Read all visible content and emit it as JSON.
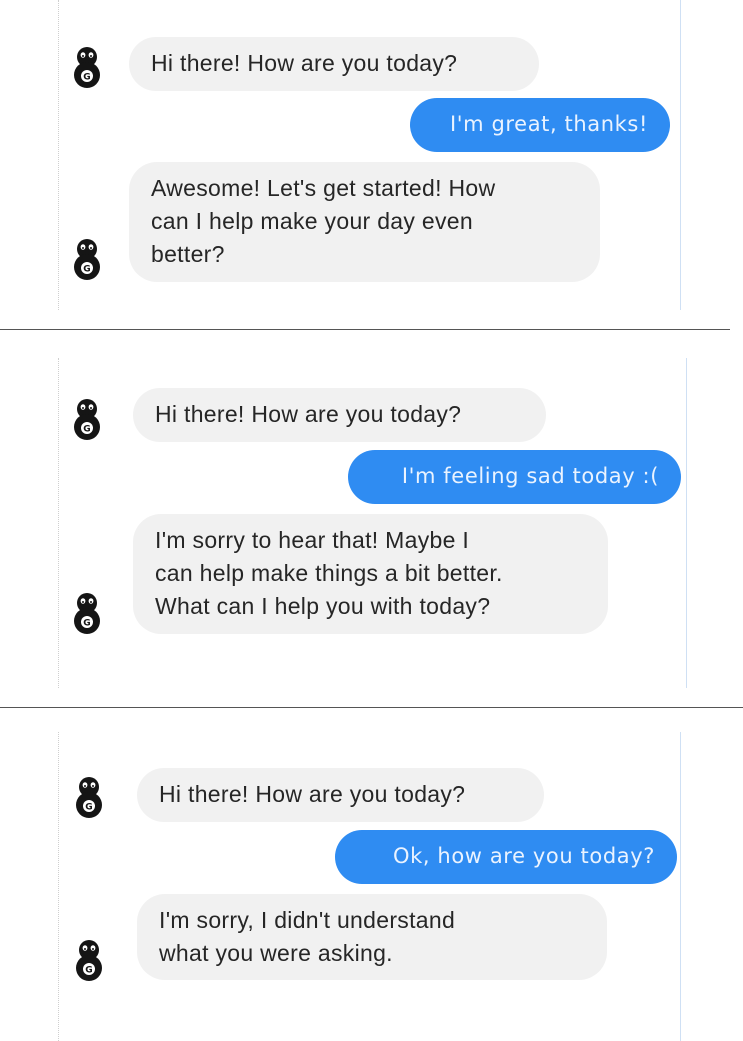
{
  "colors": {
    "user_bubble": "#2f8cf2",
    "user_text": "#eaf3ff",
    "bot_bubble": "#f1f1f1",
    "bot_text": "#262626",
    "divider": "#555555"
  },
  "avatar": {
    "icon": "bot-mascot-icon",
    "badge": "G"
  },
  "panels": [
    {
      "messages": [
        {
          "role": "bot",
          "text": "Hi there! How are you today?"
        },
        {
          "role": "user",
          "text": "I'm great, thanks!"
        },
        {
          "role": "bot",
          "text": "Awesome! Let's get started! How\ncan I help make your day even\nbetter?"
        }
      ]
    },
    {
      "messages": [
        {
          "role": "bot",
          "text": "Hi there! How are you today?"
        },
        {
          "role": "user",
          "text": "I'm feeling sad today :("
        },
        {
          "role": "bot",
          "text": "I'm sorry to hear that! Maybe I\ncan help make things a bit better.\nWhat can I help you with today?"
        }
      ]
    },
    {
      "messages": [
        {
          "role": "bot",
          "text": "Hi there! How are you today?"
        },
        {
          "role": "user",
          "text": "Ok, how are you today?"
        },
        {
          "role": "bot",
          "text": "I'm sorry, I didn't understand\nwhat you were asking."
        }
      ]
    }
  ]
}
